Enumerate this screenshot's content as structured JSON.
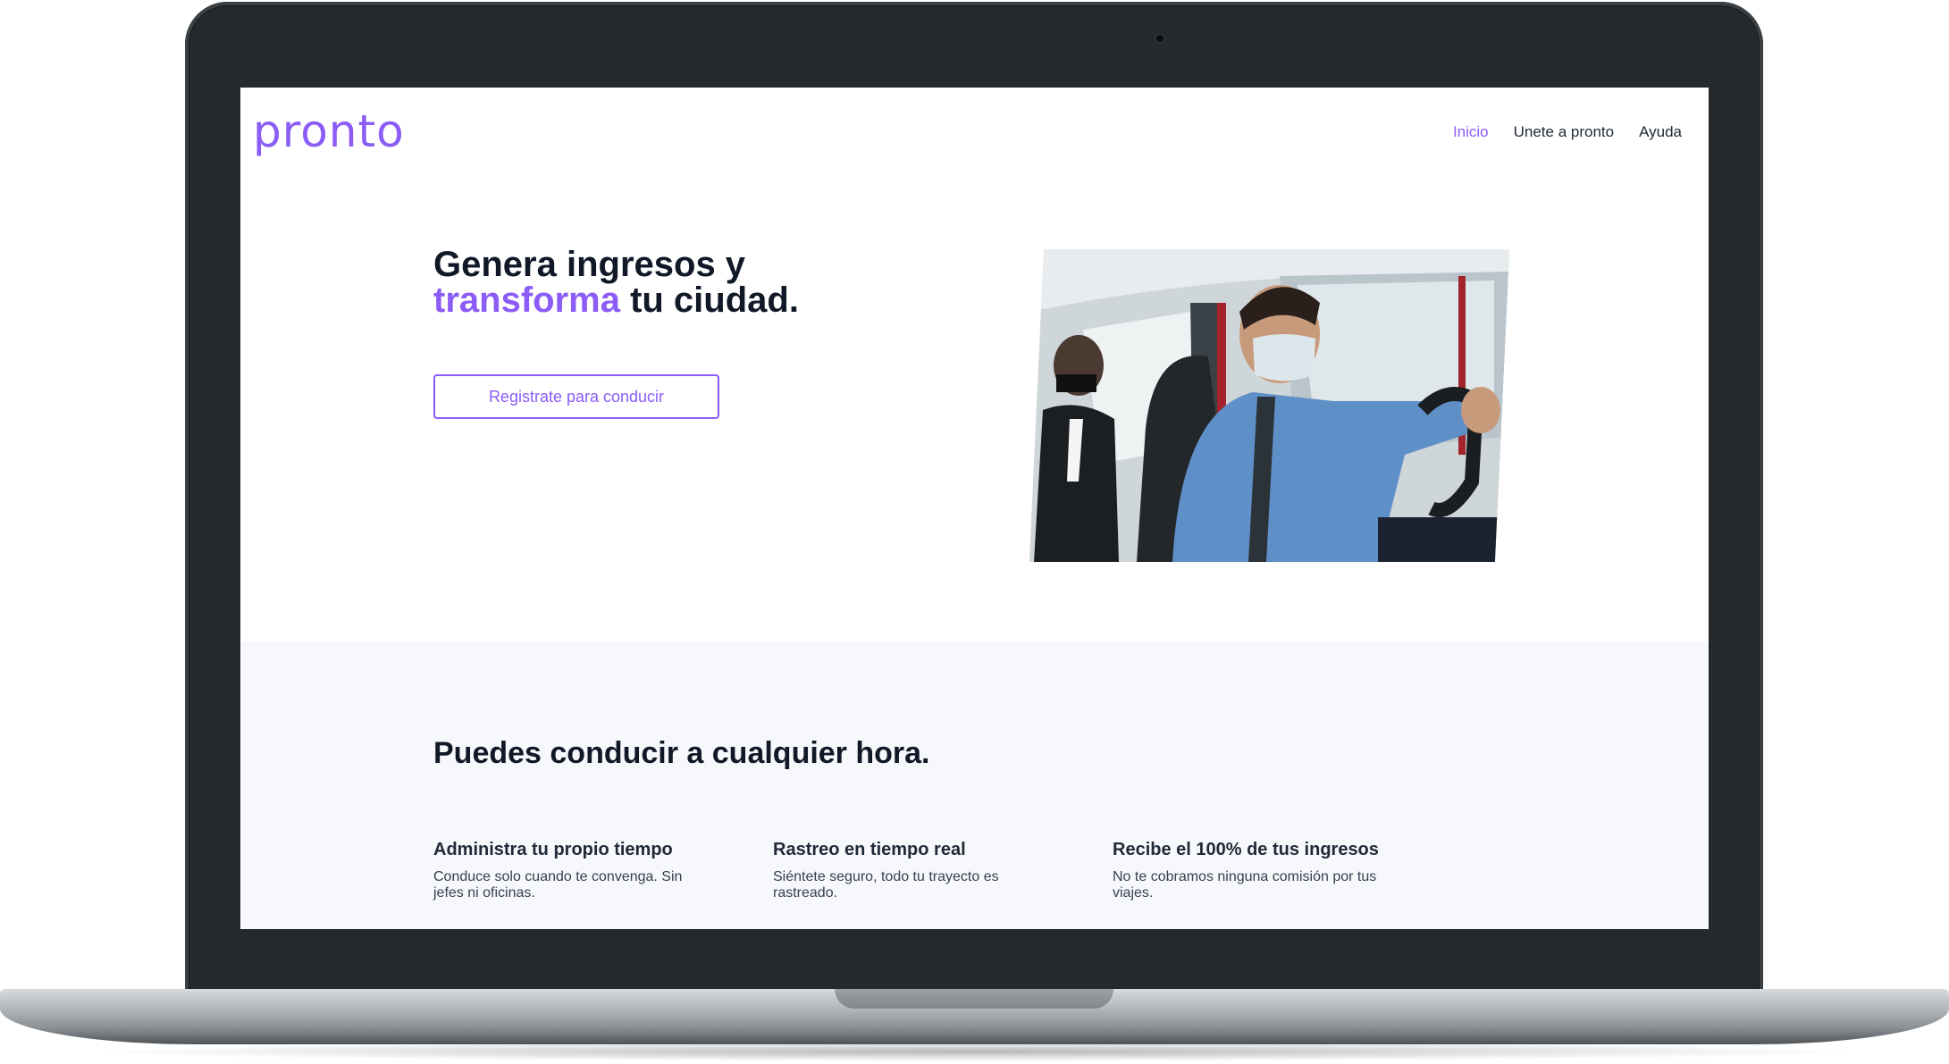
{
  "brand": {
    "logo": "pronto",
    "accent_color": "#8b5cf6"
  },
  "nav": {
    "items": [
      {
        "label": "Inicio",
        "active": true
      },
      {
        "label": "Unete a pronto",
        "active": false
      },
      {
        "label": "Ayuda",
        "active": false
      }
    ]
  },
  "hero": {
    "title_part1": "Genera ingresos y ",
    "title_accent": "transforma",
    "title_part2": " tu ciudad.",
    "cta_label": "Registrate para conducir",
    "image_icon": "driver-with-mask-photo"
  },
  "features": {
    "title": "Puedes conducir a cualquier hora.",
    "items": [
      {
        "heading": "Administra tu propio tiempo",
        "text": "Conduce solo cuando te convenga. Sin jefes ni oficinas."
      },
      {
        "heading": "Rastreo en tiempo real",
        "text": "Siéntete seguro, todo tu trayecto es rastreado."
      },
      {
        "heading": "Recibe el 100% de tus ingresos",
        "text": "No te cobramos ninguna comisión por tus viajes."
      }
    ]
  }
}
